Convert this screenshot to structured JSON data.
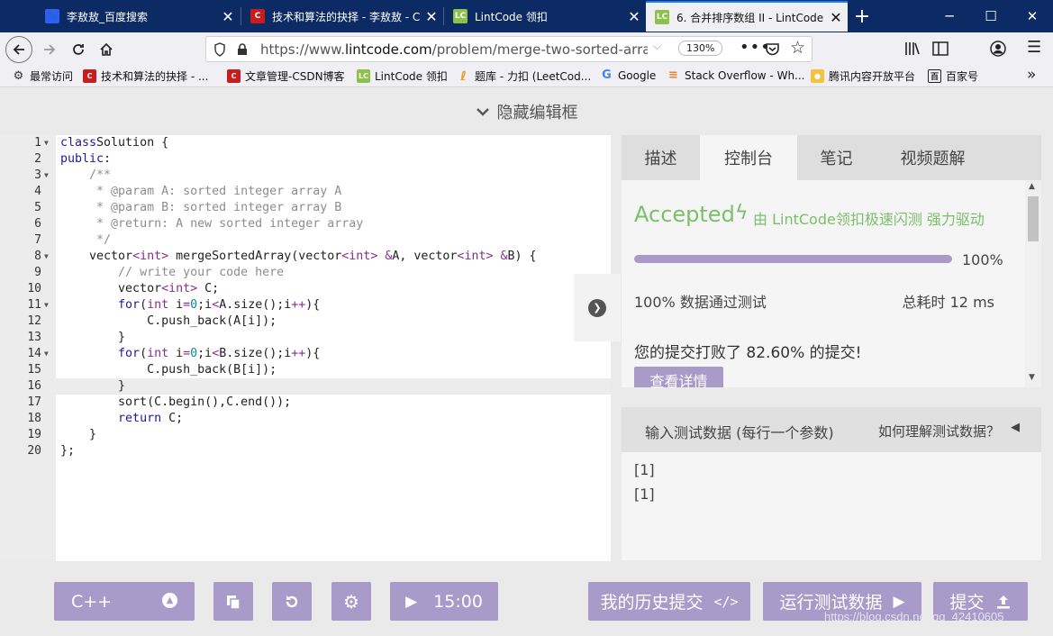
{
  "browser": {
    "tabs": [
      {
        "title": "李敖敖_百度搜索",
        "icon": "baidu-paw-icon",
        "active": false
      },
      {
        "title": "技术和算法的抉择 - 李敖敖 - C",
        "icon": "csdn-c-icon",
        "active": false
      },
      {
        "title": "LintCode 领扣",
        "icon": "lintcode-lc-icon",
        "active": false
      },
      {
        "title": "6. 合并排序数组 II - LintCode",
        "icon": "lintcode-lc-icon",
        "active": true
      }
    ],
    "url_prefix": "https://www.",
    "url_host": "lintcode.com",
    "url_path": "/problem/merge-two-sorted-arrays/de",
    "zoom": "130%",
    "bookmarks": [
      {
        "label": "最常访问",
        "icon": "gear-icon"
      },
      {
        "label": "技术和算法的抉择 - ...",
        "icon": "csdn-c-icon"
      },
      {
        "label": "文章管理-CSDN博客",
        "icon": "csdn-c-icon"
      },
      {
        "label": "LintCode 领扣",
        "icon": "lintcode-lc-icon"
      },
      {
        "label": "题库 - 力扣 (LeetCod...",
        "icon": "leetcode-icon"
      },
      {
        "label": "Google",
        "icon": "google-g-icon"
      },
      {
        "label": "Stack Overflow - Wh...",
        "icon": "stackoverflow-icon"
      },
      {
        "label": "腾讯内容开放平台",
        "icon": "tencent-icon"
      },
      {
        "label": "百家号",
        "icon": "baijiahao-icon"
      }
    ]
  },
  "app": {
    "hide_editor_label": "隐藏编辑框",
    "editor": {
      "current_line": 16,
      "lines": [
        {
          "n": "1",
          "fold": true,
          "tokens": [
            [
              "kw",
              "class"
            ],
            [
              "",
              "Solution {"
            ]
          ]
        },
        {
          "n": "2",
          "fold": false,
          "tokens": [
            [
              "kw",
              "public"
            ],
            [
              "",
              ":"
            ]
          ]
        },
        {
          "n": "3",
          "fold": true,
          "tokens": [
            [
              "",
              "    "
            ],
            [
              "cm",
              "/**"
            ]
          ]
        },
        {
          "n": "4",
          "fold": false,
          "tokens": [
            [
              "",
              "     "
            ],
            [
              "cm",
              "* @param A: sorted integer array A"
            ]
          ]
        },
        {
          "n": "5",
          "fold": false,
          "tokens": [
            [
              "",
              "     "
            ],
            [
              "cm",
              "* @param B: sorted integer array B"
            ]
          ]
        },
        {
          "n": "6",
          "fold": false,
          "tokens": [
            [
              "",
              "     "
            ],
            [
              "cm",
              "* @return: A new sorted integer array"
            ]
          ]
        },
        {
          "n": "7",
          "fold": false,
          "tokens": [
            [
              "",
              "     "
            ],
            [
              "cm",
              "*/"
            ]
          ]
        },
        {
          "n": "8",
          "fold": true,
          "tokens": [
            [
              "",
              "    vector"
            ],
            [
              "op",
              "<"
            ],
            [
              "ty",
              "int"
            ],
            [
              "op",
              ">"
            ],
            [
              "",
              " mergeSortedArray(vector"
            ],
            [
              "op",
              "<"
            ],
            [
              "ty",
              "int"
            ],
            [
              "op",
              ">"
            ],
            [
              "",
              " "
            ],
            [
              "op",
              "&"
            ],
            [
              "",
              "A, vector"
            ],
            [
              "op",
              "<"
            ],
            [
              "ty",
              "int"
            ],
            [
              "op",
              ">"
            ],
            [
              "",
              " "
            ],
            [
              "op",
              "&"
            ],
            [
              "",
              "B) {"
            ]
          ]
        },
        {
          "n": "9",
          "fold": false,
          "tokens": [
            [
              "",
              "        "
            ],
            [
              "cm",
              "// write your code here"
            ]
          ]
        },
        {
          "n": "10",
          "fold": false,
          "tokens": [
            [
              "",
              "        vector"
            ],
            [
              "op",
              "<"
            ],
            [
              "ty",
              "int"
            ],
            [
              "op",
              ">"
            ],
            [
              "",
              " C;"
            ]
          ]
        },
        {
          "n": "11",
          "fold": true,
          "tokens": [
            [
              "",
              "        "
            ],
            [
              "kw",
              "for"
            ],
            [
              "",
              "("
            ],
            [
              "ty",
              "int"
            ],
            [
              "",
              " i"
            ],
            [
              "op",
              "="
            ],
            [
              "nu",
              "0"
            ],
            [
              "",
              ";i"
            ],
            [
              "op",
              "<"
            ],
            [
              "",
              "A.size();i"
            ],
            [
              "op",
              "++"
            ],
            [
              "",
              "){"
            ]
          ]
        },
        {
          "n": "12",
          "fold": false,
          "tokens": [
            [
              "",
              "            C.push_back(A[i]);"
            ]
          ]
        },
        {
          "n": "13",
          "fold": false,
          "tokens": [
            [
              "",
              "        }"
            ]
          ]
        },
        {
          "n": "14",
          "fold": true,
          "tokens": [
            [
              "",
              "        "
            ],
            [
              "kw",
              "for"
            ],
            [
              "",
              "("
            ],
            [
              "ty",
              "int"
            ],
            [
              "",
              " i"
            ],
            [
              "op",
              "="
            ],
            [
              "nu",
              "0"
            ],
            [
              "",
              ";i"
            ],
            [
              "op",
              "<"
            ],
            [
              "",
              "B.size();i"
            ],
            [
              "op",
              "++"
            ],
            [
              "",
              "){"
            ]
          ]
        },
        {
          "n": "15",
          "fold": false,
          "tokens": [
            [
              "",
              "            C.push_back(B[i]);"
            ]
          ]
        },
        {
          "n": "16",
          "fold": false,
          "tokens": [
            [
              "",
              "        }"
            ]
          ]
        },
        {
          "n": "17",
          "fold": false,
          "tokens": [
            [
              "",
              "        sort(C.begin(),C.end());"
            ]
          ]
        },
        {
          "n": "18",
          "fold": false,
          "tokens": [
            [
              "",
              "        "
            ],
            [
              "kw",
              "return"
            ],
            [
              "",
              " C;"
            ]
          ]
        },
        {
          "n": "19",
          "fold": false,
          "tokens": [
            [
              "",
              "    }"
            ]
          ]
        },
        {
          "n": "20",
          "fold": false,
          "tokens": [
            [
              "",
              "};"
            ]
          ]
        }
      ]
    },
    "right_tabs": [
      {
        "label": "描述",
        "active": false
      },
      {
        "label": "控制台",
        "active": true
      },
      {
        "label": "笔记",
        "active": false
      },
      {
        "label": "视频题解",
        "active": false
      }
    ],
    "result": {
      "status": "Accepted",
      "powered": "由 LintCode领扣极速闪测 强力驱动",
      "progress": 1.0,
      "progress_label": "100%",
      "pass_text": "100% 数据通过测试",
      "time_text": "总耗时 12 ms",
      "beat_text": "您的提交打败了 82.60% 的提交!",
      "detail_button": "查看详情"
    },
    "test_data": {
      "header": "输入测试数据 (每行一个参数)",
      "help": "如何理解测试数据？",
      "lines": [
        "[1]",
        "[1]"
      ]
    },
    "bottom_bar": {
      "language": "C++",
      "timer": "15:00",
      "history_button": "我的历史提交",
      "run_button": "运行测试数据",
      "submit_button": "提交"
    },
    "watermark": "https://blog.csdn.net/qq_42410605"
  },
  "colors": {
    "accent": "#a99bc9",
    "accepted": "#7bbf6a",
    "titlebar": "#0c2a64"
  }
}
